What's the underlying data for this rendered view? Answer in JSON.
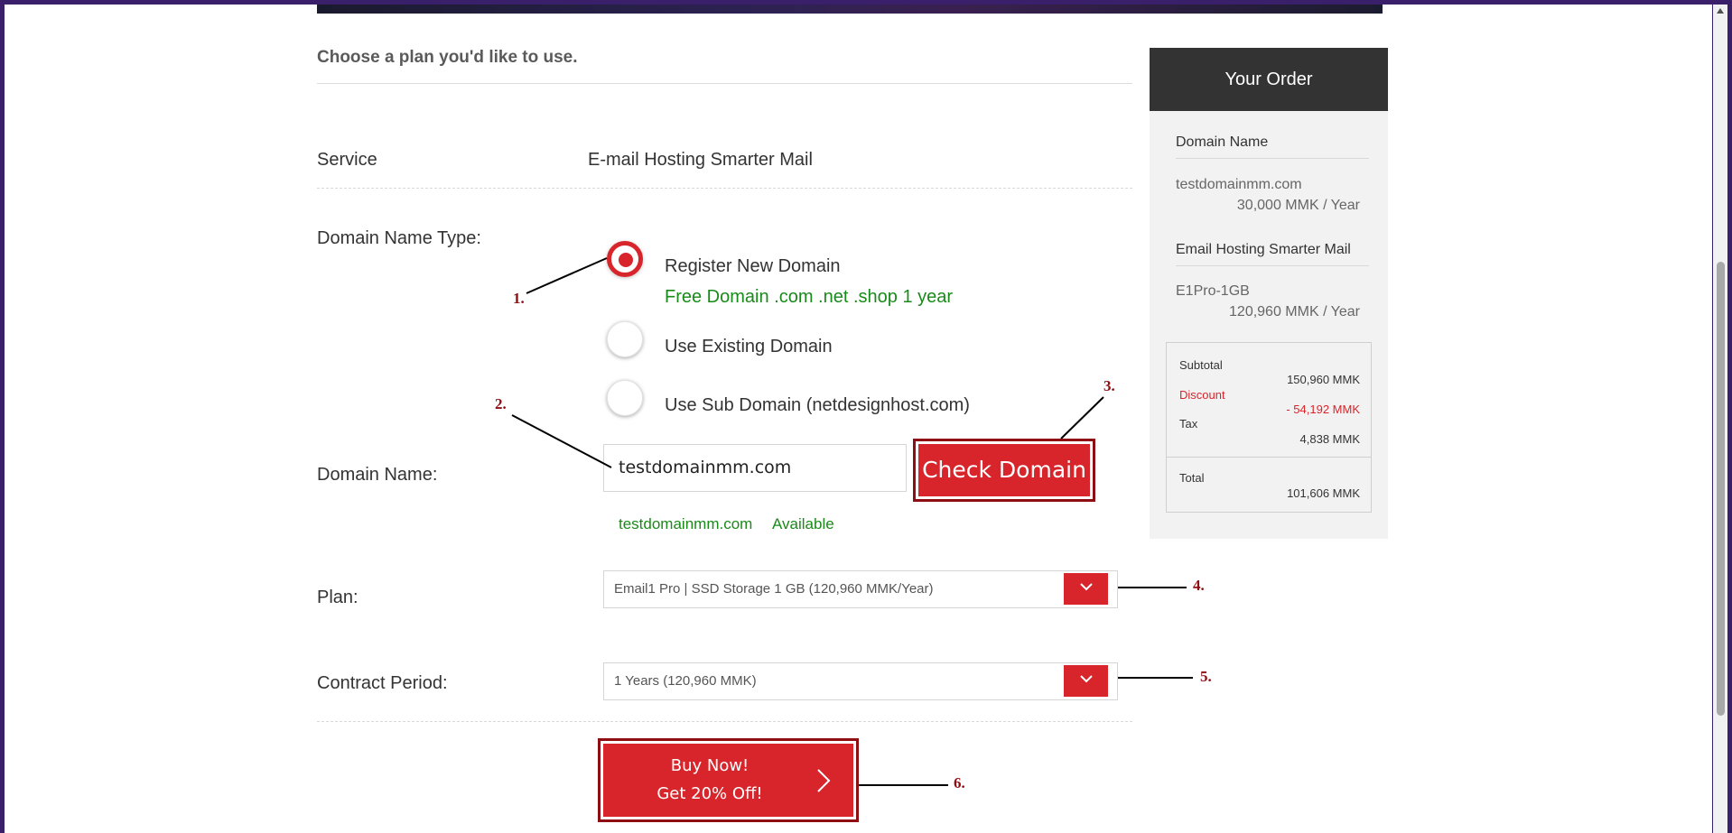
{
  "form": {
    "heading": "Choose a plan you'd like to use.",
    "service_label": "Service",
    "service_value": "E-mail Hosting Smarter Mail",
    "domain_type_label": "Domain Name Type:",
    "radio_register": "Register New Domain",
    "free_domain_note": "Free Domain .com .net .shop 1 year",
    "radio_existing": "Use Existing Domain",
    "radio_sub": "Use Sub Domain (netdesignhost.com)",
    "domain_name_label": "Domain Name:",
    "domain_input_value": "testdomainmm.com",
    "check_button": "Check Domain",
    "availability_domain": "testdomainmm.com",
    "availability_status": "Available",
    "plan_label": "Plan:",
    "plan_selected": "Email1 Pro | SSD Storage 1 GB (120,960 MMK/Year)",
    "contract_label": "Contract Period:",
    "contract_selected": "1 Years (120,960 MMK)",
    "buy_line1": "Buy Now!",
    "buy_line2": "Get 20% Off!"
  },
  "annotations": [
    "1.",
    "2.",
    "3.",
    "4.",
    "5.",
    "6."
  ],
  "order": {
    "title": "Your Order",
    "domain_section": "Domain Name",
    "domain_item": "testdomainmm.com",
    "domain_price": "30,000 MMK / Year",
    "email_section": "Email Hosting Smarter Mail",
    "email_item": "E1Pro-1GB",
    "email_price": "120,960 MMK / Year",
    "subtotal_label": "Subtotal",
    "subtotal_value": "150,960 MMK",
    "discount_label": "Discount",
    "discount_value": "- 54,192 MMK",
    "tax_label": "Tax",
    "tax_value": "4,838 MMK",
    "total_label": "Total",
    "total_value": "101,606 MMK"
  },
  "colors": {
    "accent": "#d8252b",
    "annotation": "#8e0e14",
    "available": "#1a8a1a",
    "order_header": "#333333"
  },
  "icons": [
    "chevron-down-icon",
    "chevron-right-icon",
    "scroll-up-icon"
  ]
}
